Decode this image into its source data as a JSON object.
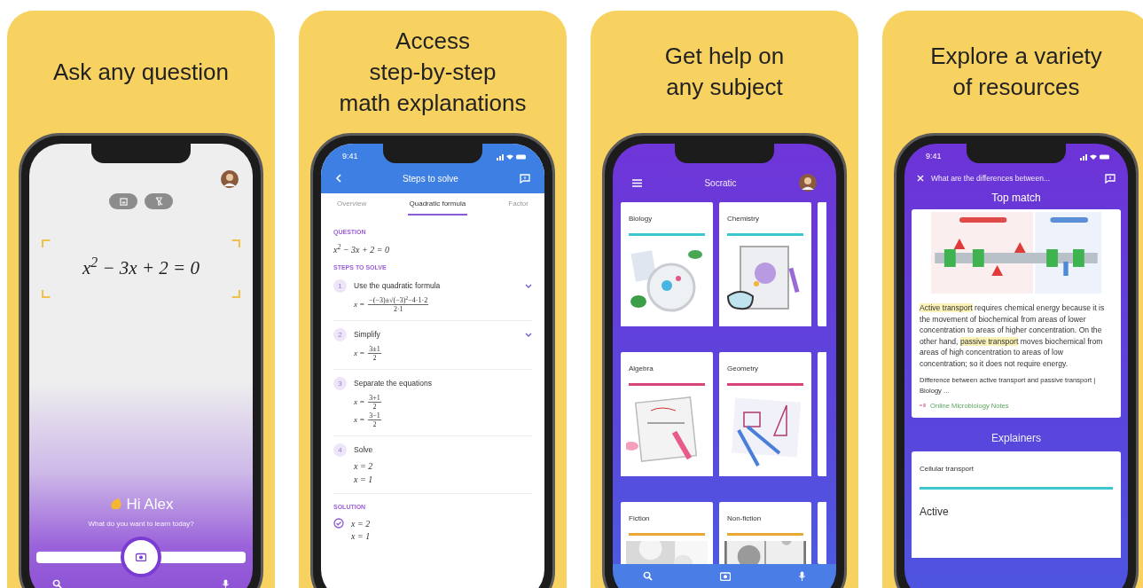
{
  "panels": [
    {
      "kind": "camera",
      "heading_lines": [
        "Ask any question"
      ],
      "equation": "x$^{2}$ − 3x + 2 = 0",
      "greeting": "Hi Alex",
      "prompt": "What do you want to learn today?"
    },
    {
      "kind": "steps",
      "heading_lines": [
        "Access",
        "step-by-step",
        "math explanations"
      ],
      "time": "9:41",
      "title": "Steps to solve",
      "tabs": [
        {
          "label": "Overview",
          "selected": false
        },
        {
          "label": "Quadratic formula",
          "selected": true
        },
        {
          "label": "Factor",
          "selected": false
        }
      ],
      "question_label": "QUESTION",
      "question": "x$^{2}$ − 3x + 2 = 0",
      "steps_label": "STEPS TO SOLVE",
      "steps": [
        {
          "number": "1",
          "title": "Use the quadratic formula",
          "expandable": true,
          "lines": [
            {
              "kind": "fraction",
              "lhs": "x =",
              "num": "−(−3)±√(−3)$^{2}$−4·1·2",
              "den": "2·1"
            }
          ]
        },
        {
          "number": "2",
          "title": "Simplify",
          "expandable": true,
          "lines": [
            {
              "kind": "fraction",
              "lhs": "x =",
              "num": "3±1",
              "den": "2"
            }
          ]
        },
        {
          "number": "3",
          "title": "Separate the equations",
          "expandable": false,
          "lines": [
            {
              "kind": "fraction",
              "lhs": "x =",
              "num": "3+1",
              "den": "2"
            },
            {
              "kind": "fraction",
              "lhs": "x =",
              "num": "3−1",
              "den": "2"
            }
          ]
        },
        {
          "number": "4",
          "title": "Solve",
          "expandable": false,
          "lines": [
            {
              "kind": "plain",
              "text": "x = 2"
            },
            {
              "kind": "plain",
              "text": "x = 1"
            }
          ]
        }
      ],
      "solution_label": "SOLUTION",
      "solution": [
        "x = 2",
        "x = 1"
      ]
    },
    {
      "kind": "subjects",
      "heading_lines": [
        "Get help on",
        "any subject"
      ],
      "title": "Socratic",
      "subjects": [
        {
          "name": "Biology",
          "color": "#3cc6cf"
        },
        {
          "name": "Chemistry",
          "color": "#3cc6cf"
        },
        {
          "name": "Algebra",
          "color": "#d8437a"
        },
        {
          "name": "Geometry",
          "color": "#d8437a"
        },
        {
          "name": "Fiction",
          "color": "#e9a733"
        },
        {
          "name": "Non-fiction",
          "color": "#e9a733"
        }
      ]
    },
    {
      "kind": "results",
      "heading_lines": [
        "Explore a variety",
        "of resources"
      ],
      "time": "9:41",
      "query": "What are the differences between...",
      "top_label": "Top match",
      "answer": "**Active transport** requires chemical energy because it is the movement of biochemical from areas of lower concentration to areas of higher concentration. On the other hand, **passive transport** moves biochemical from areas of high concentration to areas of low concentration; so it does not require energy.",
      "source_title": "Difference between active transport and passive transport | Biology ...",
      "source_name": "Online Microbiology Notes",
      "explainers_label": "Explainers",
      "explainer_title": "Cellular transport",
      "explainer_heading": "Active"
    }
  ]
}
